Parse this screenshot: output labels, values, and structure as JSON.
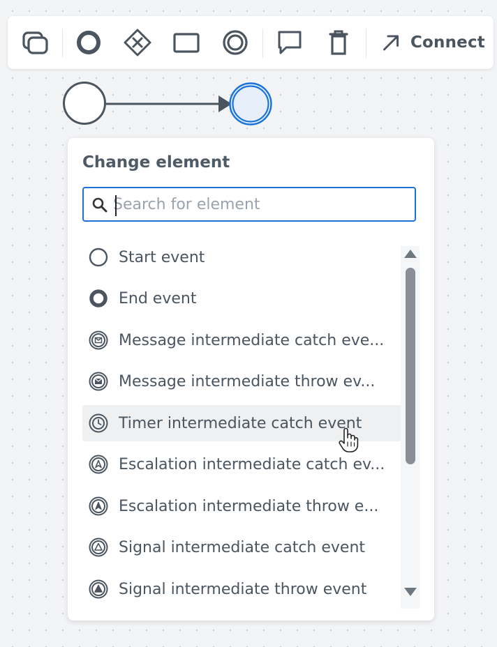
{
  "toolbar": {
    "items": [
      {
        "icon": "overlapping-squares-icon",
        "label": ""
      },
      {
        "icon": "end-event-circle-icon",
        "label": ""
      },
      {
        "icon": "gateway-diamond-icon",
        "label": ""
      },
      {
        "icon": "task-rectangle-icon",
        "label": ""
      },
      {
        "icon": "intermediate-event-circle-icon",
        "label": ""
      },
      {
        "icon": "comment-icon",
        "label": ""
      },
      {
        "icon": "trash-icon",
        "label": ""
      },
      {
        "icon": "connect-arrow-icon",
        "label": "Connect"
      }
    ],
    "connect_label": "Connect"
  },
  "popup": {
    "title": "Change element",
    "search": {
      "value": "",
      "placeholder": "Search for element"
    },
    "items": [
      {
        "label": "Start event",
        "icon": "start-event-icon"
      },
      {
        "label": "End event",
        "icon": "end-event-icon"
      },
      {
        "label": "Message intermediate catch eve...",
        "icon": "message-catch-icon"
      },
      {
        "label": "Message intermediate throw ev...",
        "icon": "message-throw-icon"
      },
      {
        "label": "Timer intermediate catch event",
        "icon": "timer-catch-icon",
        "hovered": true
      },
      {
        "label": "Escalation intermediate catch ev...",
        "icon": "escalation-catch-icon"
      },
      {
        "label": "Escalation intermediate throw e...",
        "icon": "escalation-throw-icon"
      },
      {
        "label": "Signal intermediate catch event",
        "icon": "signal-catch-icon"
      },
      {
        "label": "Signal intermediate throw event",
        "icon": "signal-throw-icon"
      }
    ]
  },
  "colors": {
    "accent": "#1a73d9",
    "icon": "#4a5560",
    "selected_fill": "#e6effa",
    "hover_row": "#eef0f2",
    "scrollbar_thumb": "#8a8f95"
  }
}
